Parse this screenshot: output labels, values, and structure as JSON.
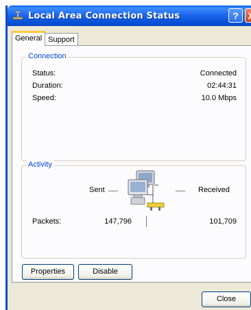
{
  "window": {
    "title": "Local Area Connection Status",
    "help_button": "?",
    "close_glyph": "X"
  },
  "tabs": [
    {
      "label": "General",
      "active": true
    },
    {
      "label": "Support",
      "active": false
    }
  ],
  "connection": {
    "group_label": "Connection",
    "status_label": "Status:",
    "status_value": "Connected",
    "duration_label": "Duration:",
    "duration_value": "02:44:31",
    "speed_label": "Speed:",
    "speed_value": "10.0 Mbps"
  },
  "activity": {
    "group_label": "Activity",
    "sent_label": "Sent",
    "received_label": "Received",
    "packets_label": "Packets:",
    "packets_sent": "147,796",
    "packets_received": "101,709",
    "icon": "network-computers-icon"
  },
  "buttons": {
    "properties": "Properties",
    "disable": "Disable",
    "close": "Close"
  },
  "colors": {
    "titlebar": "#0a5fe8",
    "group_label": "#0046d5",
    "active_tab_accent": "#ffc83c",
    "window_face": "#ece9d8"
  }
}
